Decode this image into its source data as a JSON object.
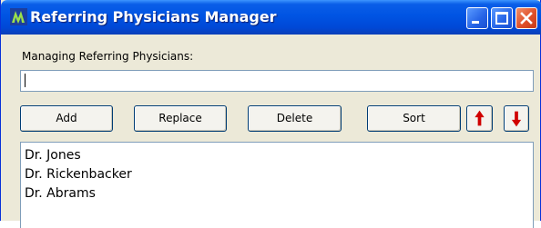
{
  "window": {
    "title": "Referring Physicians Manager",
    "app_icon": "app-logo-icon",
    "controls": [
      "minimize-icon",
      "maximize-icon",
      "close-icon"
    ]
  },
  "form": {
    "label": "Managing Referring Physicians:",
    "input_value": ""
  },
  "buttons": {
    "add": "Add",
    "replace": "Replace",
    "delete": "Delete",
    "sort": "Sort",
    "move_up_icon": "arrow-up-icon",
    "move_down_icon": "arrow-down-icon"
  },
  "list": {
    "items": [
      "Dr. Jones",
      "Dr. Rickenbacker",
      "Dr. Abrams"
    ]
  },
  "colors": {
    "titlebar": "#0054e3",
    "close": "#e0502a",
    "arrow": "#d00000",
    "face": "#ece9d8"
  }
}
